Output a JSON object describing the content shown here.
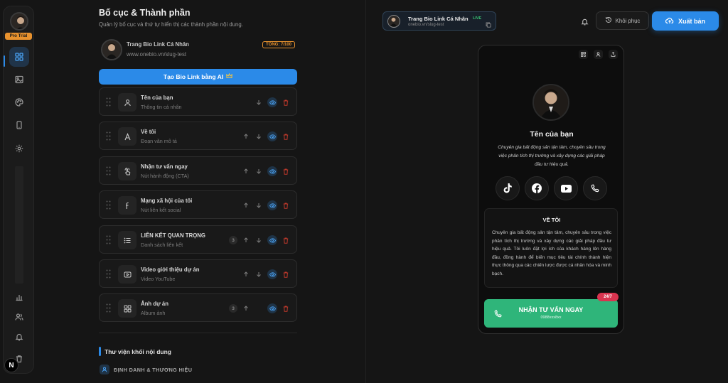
{
  "rail": {
    "pro_badge": "Pro Trial",
    "items": [
      "layout-icon",
      "image-icon",
      "palette-icon",
      "phone-icon",
      "settings-icon"
    ],
    "bottom_items": [
      "chart-icon",
      "users-icon",
      "bell-icon",
      "trash-icon"
    ],
    "brand_letter": "N"
  },
  "editor": {
    "title": "Bố cục & Thành phần",
    "subtitle": "Quản lý bố cục và thứ tự hiển thị các thành phần nội dung.",
    "profile": {
      "name": "Trang Bio Link Cá Nhân",
      "url": "www.onebio.vn/slug-test",
      "total": "TỔNG: 7/100"
    },
    "ai_button": "Tạo Bio Link bằng AI",
    "ai_icon": "crown-icon",
    "blocks": [
      {
        "title": "Tên của bạn",
        "sub": "Thông tin cá nhân",
        "icon": "user-icon",
        "count": "",
        "up": false,
        "down": true
      },
      {
        "title": "Về tôi",
        "sub": "Đoạn văn mô tả",
        "icon": "text-icon",
        "count": "",
        "up": true,
        "down": true
      },
      {
        "title": "Nhận tư vấn ngay",
        "sub": "Nút hành động (CTA)",
        "icon": "pointer-icon",
        "count": "",
        "up": true,
        "down": true
      },
      {
        "title": "Mạng xã hội của tôi",
        "sub": "Nút liên kết social",
        "icon": "facebook-icon",
        "count": "",
        "up": true,
        "down": true
      },
      {
        "title": "LIÊN KẾT QUAN TRỌNG",
        "sub": "Danh sách liên kết",
        "icon": "list-icon",
        "count": "3",
        "up": true,
        "down": true
      },
      {
        "title": "Video giới thiệu dự án",
        "sub": "Video YouTube",
        "icon": "video-icon",
        "count": "",
        "up": true,
        "down": true
      },
      {
        "title": "Ảnh dự án",
        "sub": "Album ảnh",
        "icon": "grid-icon",
        "count": "3",
        "up": true,
        "down": false
      }
    ],
    "library_title": "Thư viện khối nội dung",
    "library_group": "ĐỊNH DANH & THƯƠNG HIỆU"
  },
  "header": {
    "site_name": "Trang Bio Link Cá Nhân",
    "site_url": "onebio.vn/slug-test",
    "live": "LIVE",
    "restore": "Khôi phục",
    "publish": "Xuất bản"
  },
  "preview": {
    "name": "Tên của bạn",
    "bio": "Chuyên gia bất động sản tận tâm, chuyên sâu trong việc phân tích thị trường và xây dựng các giải pháp đầu tư hiệu quả.",
    "socials": [
      "tiktok-icon",
      "facebook-icon",
      "youtube-icon",
      "phone-icon"
    ],
    "about_title": "VỀ TÔI",
    "about_body": "Chuyên gia bất động sản tận tâm, chuyên sâu trong việc phân tích thị trường và xây dựng các giải pháp đầu tư hiệu quả. Tôi luôn đặt lợi ích của khách hàng lên hàng đầu, đồng hành để biến mục tiêu tài chính thành hiện thực thông qua các chiến lược được cá nhân hóa và minh bạch.",
    "cta_title": "NHẬN TƯ VẤN NGAY",
    "cta_sub": "0988xxx8xx",
    "badge": "24/7"
  },
  "colors": {
    "accent": "#2b8ae8",
    "cta": "#2fb57a",
    "pro": "#e8922e",
    "live": "#38c172",
    "badge": "#d9344f"
  }
}
